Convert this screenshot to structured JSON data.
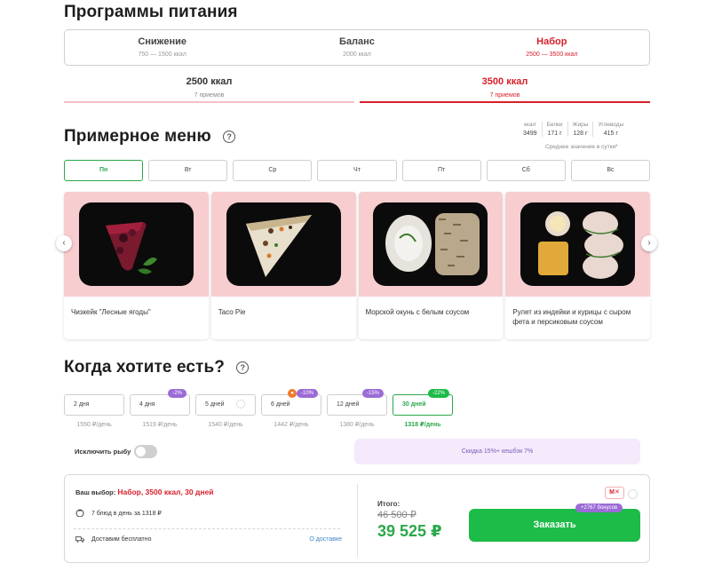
{
  "programs": {
    "title": "Программы питания",
    "items": [
      {
        "label": "Снижение",
        "range": "750 — 1500 ккал"
      },
      {
        "label": "Баланс",
        "range": "2000 ккал"
      },
      {
        "label": "Набор",
        "range": "2500 — 3500 ккал"
      }
    ],
    "active_index": 2
  },
  "kcal": {
    "items": [
      {
        "label": "2500 ккал",
        "meals": "7 приемов"
      },
      {
        "label": "3500 ккал",
        "meals": "7 приемов"
      }
    ],
    "active_index": 1
  },
  "menu": {
    "title": "Примерное меню",
    "help": "?",
    "nutrition": [
      {
        "label": "ккал",
        "value": "3499"
      },
      {
        "label": "Белки",
        "value": "171 г"
      },
      {
        "label": "Жиры",
        "value": "128 г"
      },
      {
        "label": "Углеводы",
        "value": "415 г"
      }
    ],
    "nutrition_note": "Среднее значение в сутки*",
    "days": [
      "Пн",
      "Вт",
      "Ср",
      "Чт",
      "Пт",
      "Сб",
      "Вс"
    ],
    "active_day": 0,
    "dishes": [
      {
        "name": "Чизкейк \"Лесные ягоды\""
      },
      {
        "name": "Taco Pie"
      },
      {
        "name": "Морской окунь с белым соусом"
      },
      {
        "name": "Рулет из индейки и курицы с сыром фета и персиковым соусом"
      }
    ],
    "prev_arrow": "‹",
    "next_arrow": "›"
  },
  "schedule": {
    "title": "Когда хотите есть?",
    "help": "?",
    "options": [
      {
        "label": "2 дня",
        "price": "1550 ₽/день",
        "badge": ""
      },
      {
        "label": "4 дня",
        "price": "1519 ₽/день",
        "badge": "-2%"
      },
      {
        "label": "5 дней",
        "price": "1540 ₽/день",
        "badge": ""
      },
      {
        "label": "6 дней",
        "price": "1442 ₽/день",
        "badge": "-10%"
      },
      {
        "label": "12 дней",
        "price": "1380 ₽/день",
        "badge": "-15%"
      },
      {
        "label": "30 дней",
        "price": "1318 ₽/день",
        "badge": "-22%"
      }
    ],
    "active_index": 5,
    "fish_toggle_label": "Исключить рыбу",
    "fish_toggle_on": false,
    "discount_text": "Скидка 15%+ кешбэк 7%",
    "fire_icon": "fire-icon"
  },
  "order": {
    "choice_label": "Ваш выбор:",
    "choice_value": "Набор, 3500 ккал, 30 дней",
    "meals_line": "7 блюд в день за 1318 ₽",
    "delivery_line": "Доставим бесплатно",
    "delivery_link": "О доставке",
    "total_label": "Итого:",
    "old_price": "46 500 ₽",
    "new_price": "39 525 ₽",
    "order_button": "Заказать",
    "bonus_badge": "+2767 бонусов",
    "mk_label": "М✕"
  },
  "colors": {
    "brand_red": "#d71f2a",
    "green": "#1dbb47",
    "purple": "#9b6bd6",
    "pink": "#f7cdd0"
  }
}
